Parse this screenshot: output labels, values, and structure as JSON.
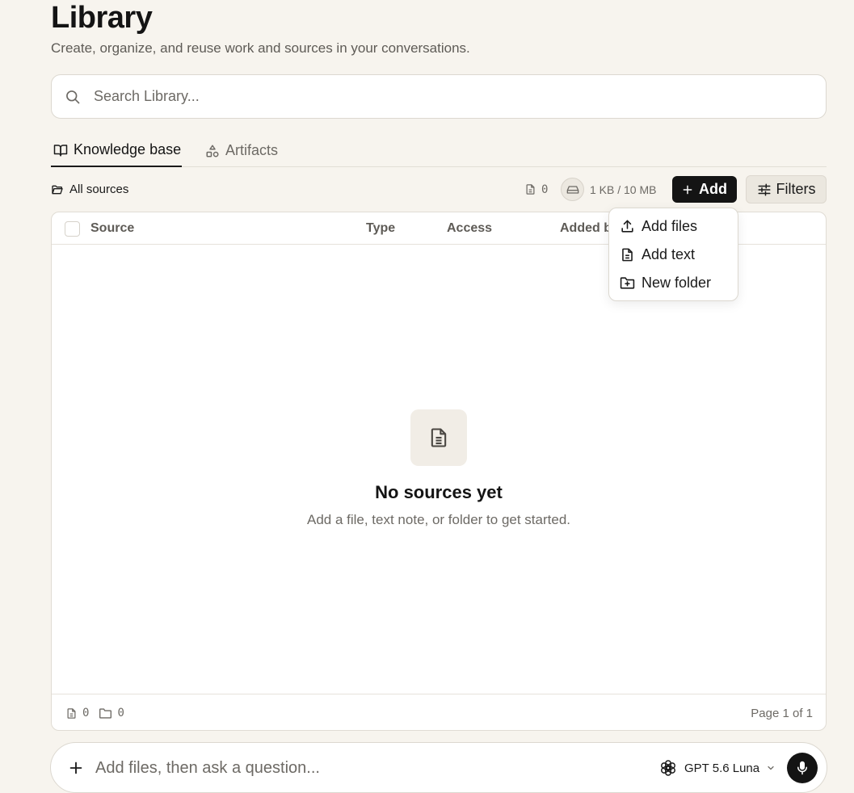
{
  "header": {
    "title": "Library",
    "subtitle": "Create, organize, and reuse work and sources in your conversations."
  },
  "search": {
    "placeholder": "Search Library...",
    "icon": "search-icon"
  },
  "tabs": [
    {
      "label": "Knowledge base",
      "icon": "book-open-icon",
      "active": true
    },
    {
      "label": "Artifacts",
      "icon": "shapes-icon",
      "active": false
    }
  ],
  "toolbar": {
    "breadcrumb": "All sources",
    "file_count": "0",
    "storage": "1 KB / 10 MB",
    "add_label": "Add",
    "filters_label": "Filters"
  },
  "table": {
    "columns": [
      "Source",
      "Type",
      "Access",
      "Added b"
    ],
    "empty_title": "No sources yet",
    "empty_subtitle": "Add a file, text note, or folder to get started.",
    "footer": {
      "file_count": "0",
      "folder_count": "0",
      "page_indicator": "Page 1 of 1"
    }
  },
  "add_menu": {
    "items": [
      {
        "label": "Add files",
        "icon": "upload-icon"
      },
      {
        "label": "Add text",
        "icon": "file-text-icon"
      },
      {
        "label": "New folder",
        "icon": "folder-plus-icon"
      }
    ]
  },
  "composer": {
    "placeholder": "Add files, then ask a question...",
    "model": "GPT 5.6 Luna"
  },
  "colors": {
    "background": "#f7f4ee",
    "primary_button": "#141414",
    "muted_text": "#6d6a65"
  }
}
